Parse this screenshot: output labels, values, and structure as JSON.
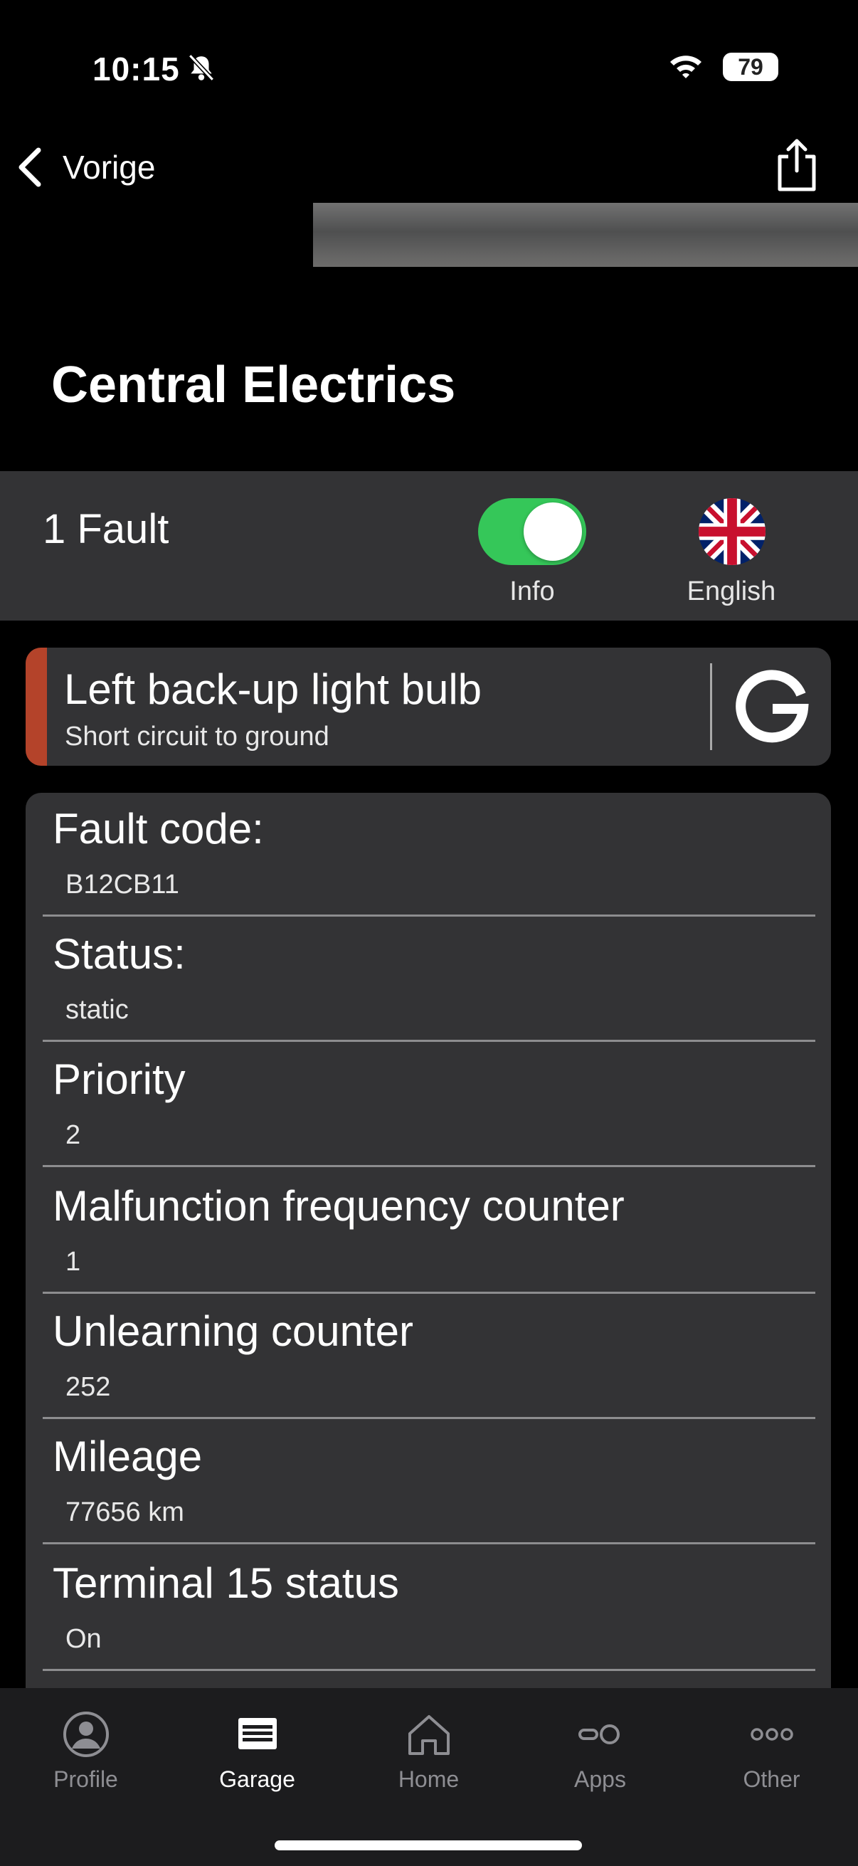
{
  "status_bar": {
    "time": "10:15",
    "battery": "79"
  },
  "nav": {
    "back_label": "Vorige"
  },
  "header": {
    "title": "Central Electrics"
  },
  "fault_bar": {
    "count_label": "1 Fault",
    "toggle_label": "Info",
    "toggle_on": true,
    "language_label": "English"
  },
  "fault": {
    "name": "Left back-up light bulb",
    "description": "Short circuit to ground",
    "accent_color": "#b4432a"
  },
  "details": [
    {
      "label": "Fault code:",
      "value": "B12CB11"
    },
    {
      "label": "Status:",
      "value": "static"
    },
    {
      "label": "Priority",
      "value": "2"
    },
    {
      "label": "Malfunction frequency counter",
      "value": "1"
    },
    {
      "label": "Unlearning counter",
      "value": "252"
    },
    {
      "label": "Mileage",
      "value": "77656 km"
    },
    {
      "label": "Terminal 15 status",
      "value": "On"
    }
  ],
  "tabs": [
    {
      "label": "Profile",
      "icon": "person-icon",
      "active": false
    },
    {
      "label": "Garage",
      "icon": "garage-icon",
      "active": true
    },
    {
      "label": "Home",
      "icon": "house-icon",
      "active": false
    },
    {
      "label": "Apps",
      "icon": "apps-icon",
      "active": false
    },
    {
      "label": "Other",
      "icon": "more-icon",
      "active": false
    }
  ],
  "colors": {
    "toggle_on": "#35c759",
    "accent": "#b4432a",
    "card_bg": "#333335"
  }
}
